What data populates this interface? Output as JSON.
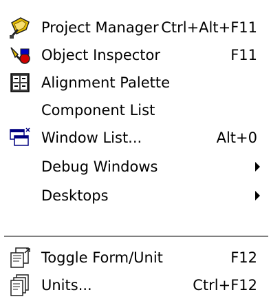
{
  "menu": {
    "items": [
      {
        "label": "Project Manager",
        "shortcut": "Ctrl+Alt+F11",
        "icon": "project-manager-icon"
      },
      {
        "label": "Object Inspector",
        "shortcut": "F11",
        "icon": "object-inspector-icon"
      },
      {
        "label": "Alignment Palette",
        "shortcut": "",
        "icon": "alignment-palette-icon"
      },
      {
        "label": "Component List",
        "shortcut": "",
        "icon": ""
      },
      {
        "label": "Window List...",
        "shortcut": "Alt+0",
        "icon": "window-list-icon"
      },
      {
        "label": "Debug Windows",
        "shortcut": "",
        "icon": "",
        "submenu": true
      },
      {
        "label": "Desktops",
        "shortcut": "",
        "icon": "",
        "submenu": true
      },
      {
        "label": "Toggle Form/Unit",
        "shortcut": "F12",
        "icon": "toggle-form-unit-icon"
      },
      {
        "label": "Units...",
        "shortcut": "Ctrl+F12",
        "icon": "units-icon"
      }
    ]
  },
  "colors": {
    "background": "#ffffff",
    "text": "#000000",
    "separator_dark": "#808080",
    "icon_yellow": "#e8c000",
    "icon_red": "#d00000",
    "icon_blue": "#0000c0",
    "icon_dark": "#202020"
  }
}
